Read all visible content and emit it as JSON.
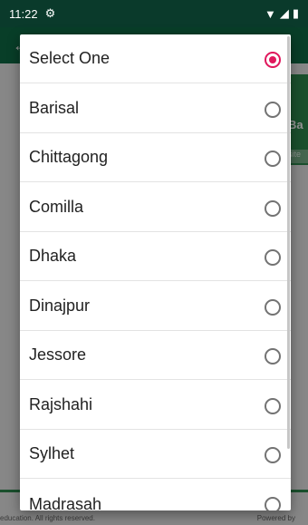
{
  "status": {
    "time": "11:22",
    "icons": [
      "settings-gear-icon",
      "wifi-icon",
      "signal-icon",
      "battery-icon"
    ]
  },
  "background": {
    "banner_text": "Ba",
    "banner_sub": "site",
    "footer_left": "education. All rights reserved.",
    "footer_right": "Powered by"
  },
  "dialog": {
    "options": [
      {
        "label": "Select One",
        "selected": true
      },
      {
        "label": "Barisal",
        "selected": false
      },
      {
        "label": "Chittagong",
        "selected": false
      },
      {
        "label": "Comilla",
        "selected": false
      },
      {
        "label": "Dhaka",
        "selected": false
      },
      {
        "label": "Dinajpur",
        "selected": false
      },
      {
        "label": "Jessore",
        "selected": false
      },
      {
        "label": "Rajshahi",
        "selected": false
      },
      {
        "label": "Sylhet",
        "selected": false
      },
      {
        "label": "Madrasah",
        "selected": false
      }
    ]
  },
  "colors": {
    "accent": "#e0185d",
    "app_bar": "#0f6b46",
    "status_bar": "#0a3a2b"
  }
}
